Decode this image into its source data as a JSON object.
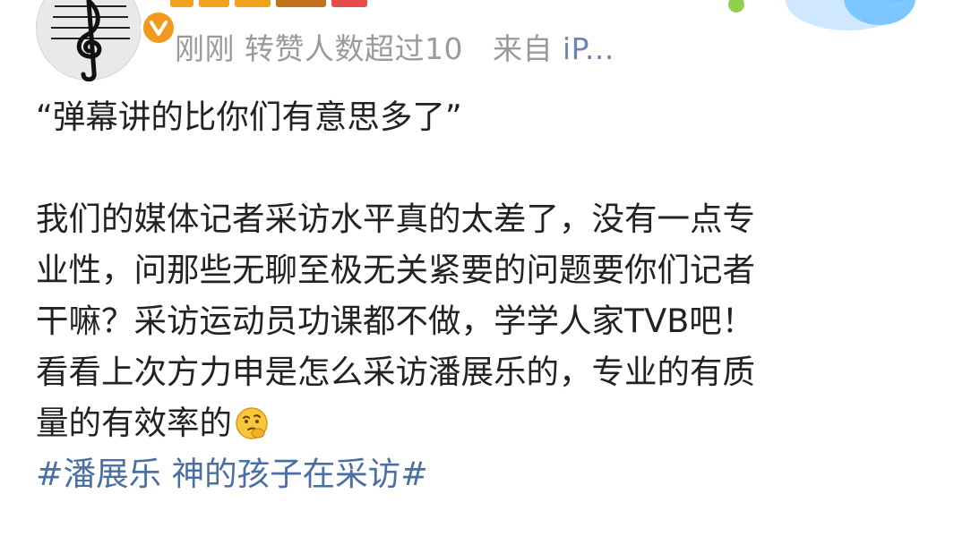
{
  "post": {
    "meta": {
      "time": "刚刚",
      "reposts": "转赞人数超过10",
      "source_prefix": "来自",
      "source_device": "iP..."
    },
    "quote": "“弹幕讲的比你们有意思多了”",
    "paragraphs": [
      "我们的媒体记者采访水平真的太差了，没有一点专",
      "业性，问那些无聊至极无关紧要的问题要你们记者",
      "干嘛？采访运动员功课都不做，学学人家TVB吧！",
      "看看上次方力申是怎么采访潘展乐的，专业的有质",
      "量的有效率的"
    ],
    "emoji": "thinking-face-emoji",
    "hashtag": "#潘展乐 神的孩子在采访#"
  },
  "colors": {
    "text": "#222222",
    "meta": "#9a9a9a",
    "link": "#4a6fa5",
    "verified_badge": "#f29a1e"
  }
}
